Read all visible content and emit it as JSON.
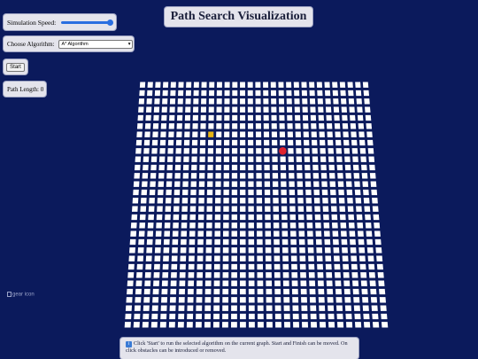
{
  "header": {
    "title": "Path Search Visualization"
  },
  "controls": {
    "speed_label": "Simulation Speed:",
    "speed_value_fraction": 0.95,
    "algorithm_label": "Choose Algorithm:",
    "algorithm_selected": "A* Algorithm",
    "start_label": "Start",
    "path_length_label": "Path Length: 0"
  },
  "grid": {
    "rows": 30,
    "cols": 30,
    "start_cell": {
      "row": 6,
      "col": 9
    },
    "finish_cell": {
      "row": 8,
      "col": 18
    },
    "colors": {
      "cell": "#ffffff",
      "line": "#0b1a5c",
      "start": "#e6b414",
      "finish": "#e0232e"
    }
  },
  "broken_image": {
    "alt": "gear icon"
  },
  "info": {
    "icon_glyph": "i",
    "text": "Click 'Start' to run the selected algorithm on the current graph. Start and Finish can be moved. On click obstacles can be introduced or removed."
  }
}
